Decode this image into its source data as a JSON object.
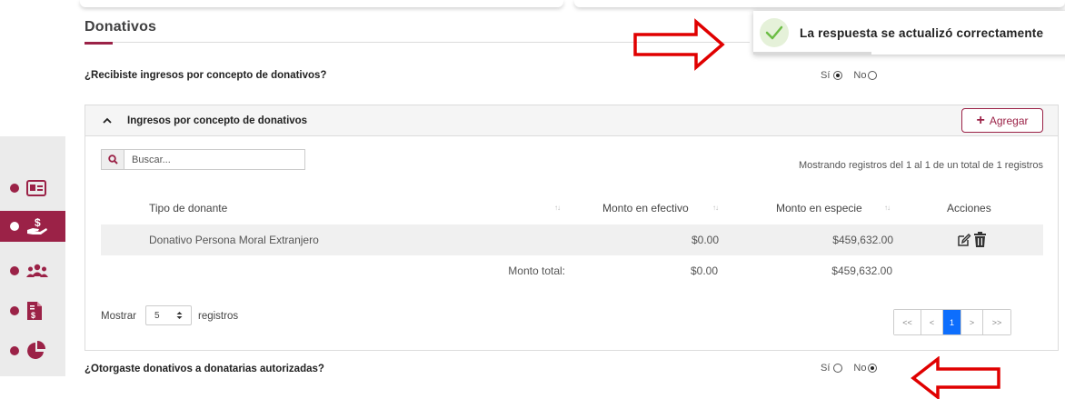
{
  "section": {
    "title": "Donativos"
  },
  "toast": {
    "message": "La respuesta se actualizó correctamente"
  },
  "question1": {
    "text": "¿Recibiste ingresos por concepto de donativos?",
    "yes": "Sí",
    "no": "No",
    "selected": "yes"
  },
  "panel": {
    "title": "Ingresos por concepto de donativos",
    "add_label": "Agregar",
    "search_placeholder": "Buscar...",
    "records_info": "Mostrando registros del 1 al 1 de un total de 1 registros",
    "columns": [
      "Tipo de donante",
      "Monto en efectivo",
      "Monto en especie",
      "Acciones"
    ],
    "rows": [
      {
        "tipo": "Donativo Persona Moral Extranjero",
        "efectivo": "$0.00",
        "especie": "$459,632.00"
      }
    ],
    "totals": {
      "label": "Monto total:",
      "efectivo": "$0.00",
      "especie": "$459,632.00"
    },
    "show_label": "Mostrar",
    "page_size": "5",
    "records_label": "registros",
    "pagination": {
      "first": "<<",
      "prev": "<",
      "current": "1",
      "next": ">",
      "last": ">>"
    }
  },
  "question2": {
    "text": "¿Otorgaste donativos a donatarias autorizadas?",
    "yes": "Sí",
    "no": "No",
    "selected": "no"
  },
  "sidebar": {
    "items": [
      {
        "icon": "id-card-icon",
        "active": false
      },
      {
        "icon": "donation-hand-icon",
        "active": true
      },
      {
        "icon": "people-group-icon",
        "active": false
      },
      {
        "icon": "invoice-file-icon",
        "active": false
      },
      {
        "icon": "pie-chart-icon",
        "active": false
      }
    ]
  },
  "colors": {
    "accent": "#9b2247",
    "pagination_active": "#0d6efd",
    "annotation_arrow": "#e00000",
    "success": "#6cbd45"
  }
}
